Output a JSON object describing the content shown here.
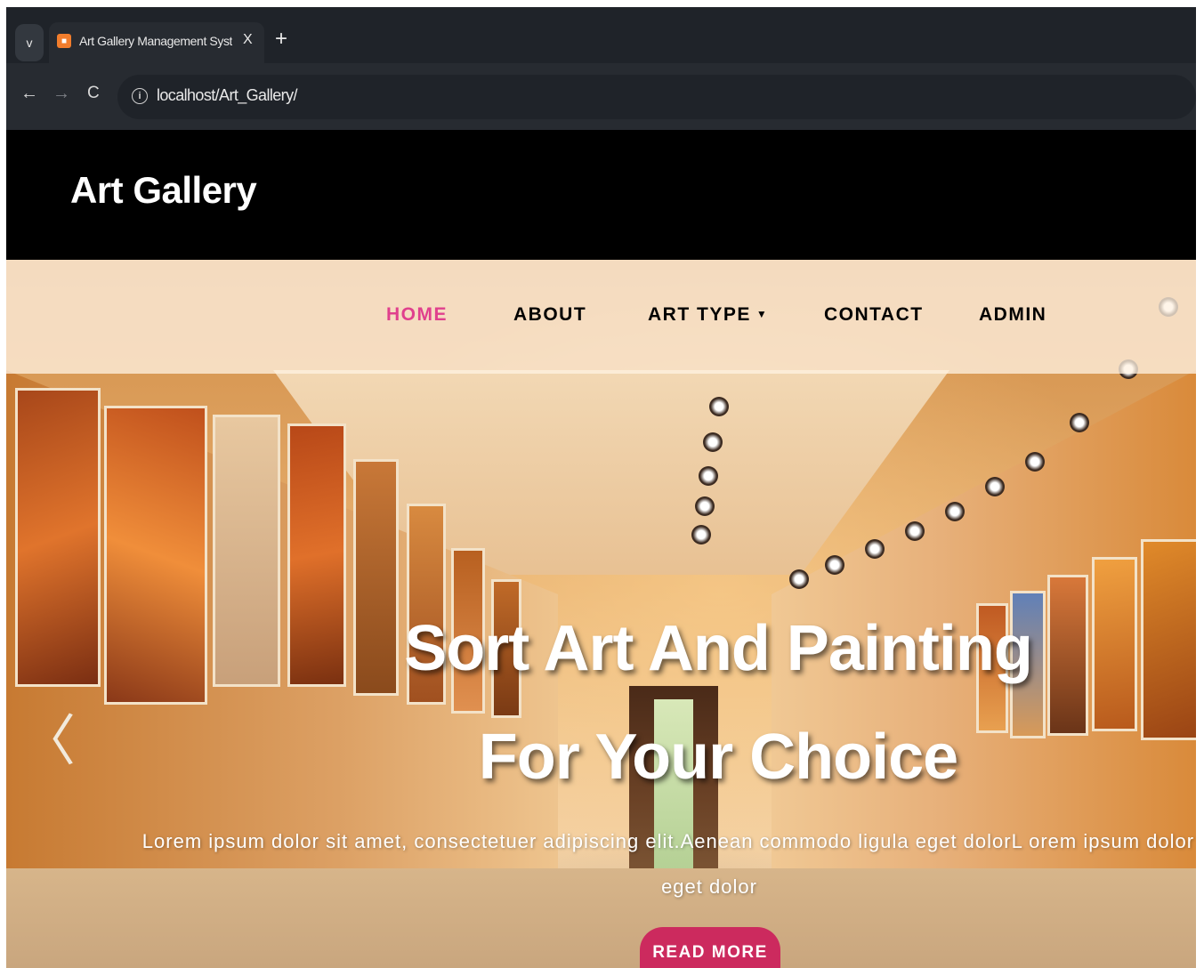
{
  "browser": {
    "tab_title": "Art Gallery Management System",
    "tab_close": "X",
    "new_tab": "+",
    "tab_list": "v",
    "url": "localhost/Art_Gallery/",
    "back": "←",
    "forward": "→",
    "reload": "C",
    "info": "i"
  },
  "site": {
    "brand": "Art Gallery",
    "nav": [
      {
        "label": "HOME",
        "active": true
      },
      {
        "label": "ABOUT",
        "active": false
      },
      {
        "label": "ART TYPE",
        "active": false
      },
      {
        "label": "CONTACT",
        "active": false
      },
      {
        "label": "ADMIN",
        "active": false
      }
    ],
    "nav_caret": "▼",
    "accent_color": "#e0408d",
    "button_color": "#cc2a5e"
  },
  "hero": {
    "title_line1": "Sort Art And Painting",
    "title_line2": "For Your Choice",
    "subtitle": "Lorem ipsum dolor sit amet, consectetuer adipiscing elit.Aenean commodo ligula eget dolorL orem ipsum dolor sit amet eget dolor",
    "button": "READ MORE",
    "prev_arrow": "〈"
  }
}
